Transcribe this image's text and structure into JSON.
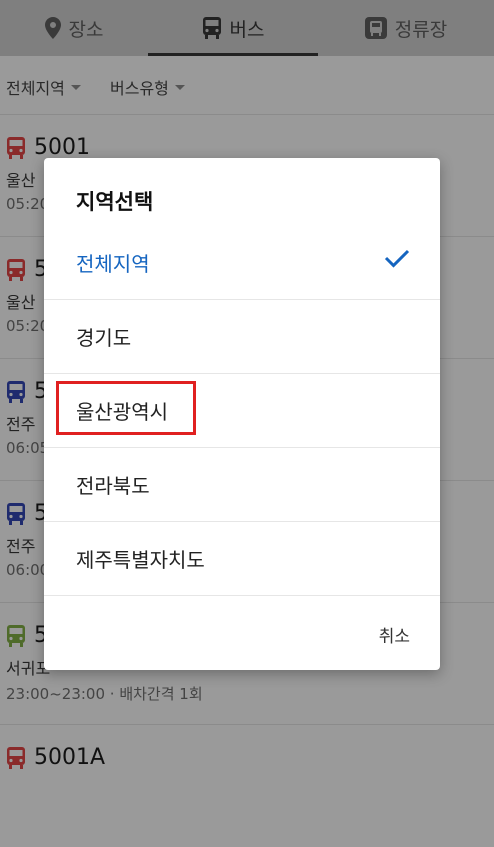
{
  "tabs": [
    {
      "label": "장소",
      "icon": "location-pin-icon"
    },
    {
      "label": "버스",
      "icon": "bus-icon"
    },
    {
      "label": "정류장",
      "icon": "bus-stop-icon"
    }
  ],
  "filters": {
    "region": "전체지역",
    "bus_type": "버스유형"
  },
  "bus_list": [
    {
      "number": "5001",
      "route": "울산",
      "time": "05:20",
      "color": "#b71c1c"
    },
    {
      "number": "5",
      "route": "울산",
      "time": "05:20",
      "color": "#b71c1c"
    },
    {
      "number": "5",
      "route": "전주",
      "time": "06:05",
      "color": "#1a237e"
    },
    {
      "number": "5",
      "route": "전주",
      "time": "06:00",
      "color": "#1a237e"
    },
    {
      "number": "5",
      "route": "서귀포",
      "time": "23:00~23:00 · 배차간격 1회",
      "color": "#558b2f"
    },
    {
      "number": "5001A",
      "route": "",
      "time": "",
      "color": "#b71c1c"
    }
  ],
  "dialog": {
    "title": "지역선택",
    "options": [
      "전체지역",
      "경기도",
      "울산광역시",
      "전라북도",
      "제주특별자치도"
    ],
    "selected": "전체지역",
    "cancel_label": "취소"
  },
  "colors": {
    "accent": "#1565c0",
    "highlight": "#e02020"
  }
}
